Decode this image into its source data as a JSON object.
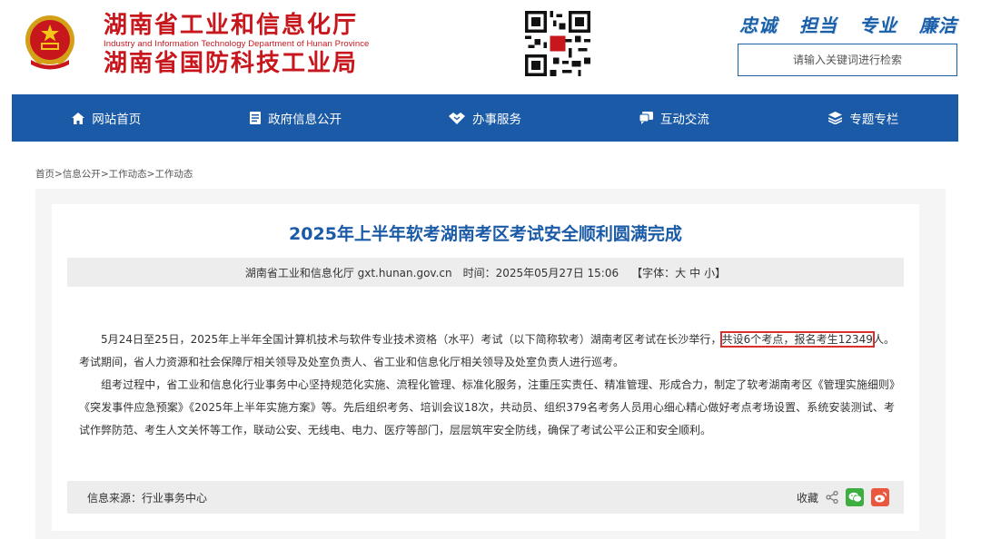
{
  "header": {
    "title_line1": "湖南省工业和信息化厅",
    "title_english": "Industry and Information Technology Department of Hunan Province",
    "title_line2": "湖南省国防科技工业局",
    "slogans": [
      "忠诚",
      "担当",
      "专业",
      "廉洁"
    ],
    "search_placeholder": "请输入关键词进行检索",
    "brand_color": "#c8161d",
    "accent_color": "#1a5aa6"
  },
  "nav": {
    "items": [
      {
        "label": "网站首页",
        "icon": "home-icon"
      },
      {
        "label": "政府信息公开",
        "icon": "document-icon"
      },
      {
        "label": "办事服务",
        "icon": "handshake-icon"
      },
      {
        "label": "互动交流",
        "icon": "chat-icon"
      },
      {
        "label": "专题专栏",
        "icon": "layers-icon"
      }
    ]
  },
  "breadcrumb": {
    "items": [
      "首页",
      "信息公开",
      "工作动态",
      "工作动态"
    ],
    "separator": ">"
  },
  "article": {
    "title": "2025年上半年软考湖南考区考试安全顺利圆满完成",
    "meta": {
      "source_site": "湖南省工业和信息化厅 gxt.hunan.gov.cn",
      "time_label": "时间：",
      "time": "2025年05月27日 15:06",
      "font_label_open": "【字体：",
      "font_large": "大",
      "font_medium": "中",
      "font_small": "小",
      "font_label_close": "】"
    },
    "p1_before": "5月24日至25日，2025年上半年全国计算机技术与软件专业技术资格（水平）考试（以下简称软考）湖南考区考试在长沙举行，",
    "p1_highlight": "共设6个考点，报名考生12349",
    "p1_after": "人。考试期间，省人力资源和社会保障厅相关领导及处室负责人、省工业和信息化厅相关领导及处室负责人进行巡考。",
    "p2": "组考过程中，省工业和信息化行业事务中心坚持规范化实施、流程化管理、标准化服务，注重压实责任、精准管理、形成合力，制定了软考湖南考区《管理实施细则》《突发事件应急预案》《2025年上半年实施方案》等。先后组织考务、培训会议18次，共动员、组织379名考务人员用心细心精心做好考点考场设置、系统安装测试、考试作弊防范、考生人文关怀等工作，联动公安、无线电、电力、医疗等部门，层层筑牢安全防线，确保了考试公平公正和安全顺利。",
    "info_source": "信息来源：行业事务中心",
    "favorite_label": "收藏",
    "share_colors": {
      "wechat": "#3dae3f",
      "weibo": "#e9573f"
    }
  }
}
